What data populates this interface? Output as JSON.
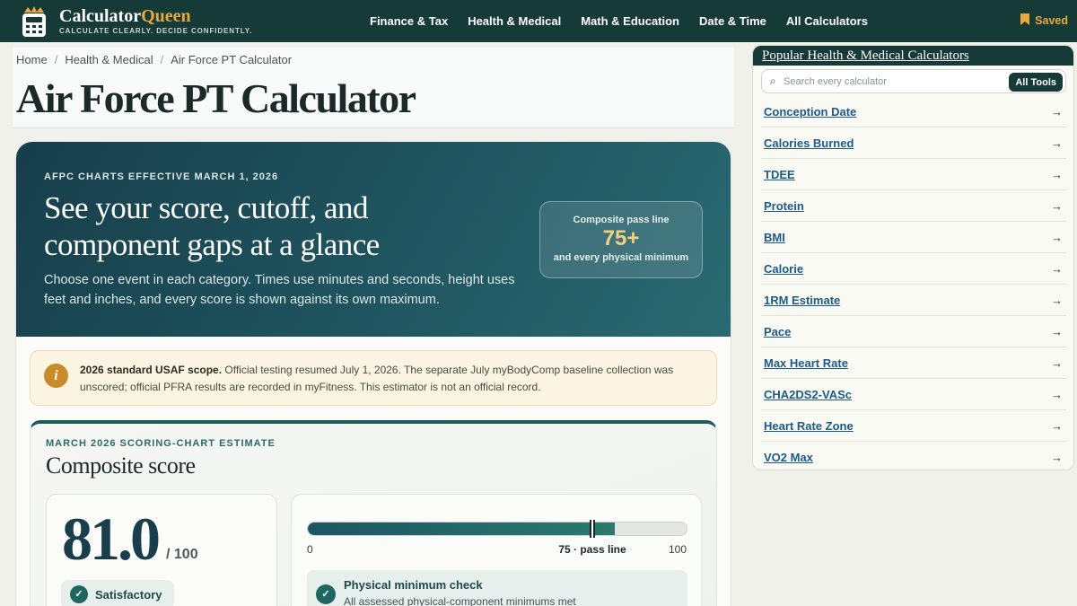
{
  "brand": {
    "name_main": "Calculator",
    "name_accent": "Queen",
    "tagline": "CALCULATE CLEARLY. DECIDE CONFIDENTLY."
  },
  "nav": {
    "items": [
      "Finance & Tax",
      "Health & Medical",
      "Math & Education",
      "Date & Time",
      "All Calculators"
    ],
    "saved_label": "Saved"
  },
  "breadcrumb": [
    "Home",
    "Health & Medical",
    "Air Force PT Calculator"
  ],
  "page_title": "Air Force PT Calculator",
  "hero": {
    "kicker": "AFPC CHARTS EFFECTIVE MARCH 1, 2026",
    "heading": "See your score, cutoff, and component gaps at a glance",
    "description": "Choose one event in each category. Times use minutes and seconds, height uses feet and inches, and every score is shown against its own maximum.",
    "pass_box": {
      "label": "Composite pass line",
      "value": "75+",
      "sub": "and every physical minimum"
    }
  },
  "notice": {
    "bold": "2026 standard USAF scope.",
    "text": " Official testing resumed July 1, 2026. The separate July myBodyComp baseline collection was unscored; official PFRA results are recorded in myFitness. This estimator is not an official record."
  },
  "score": {
    "kicker": "MARCH 2026 SCORING-CHART ESTIMATE",
    "title": "Composite score",
    "value": "81.0",
    "max_label": "/ 100",
    "status": "Satisfactory",
    "bar": {
      "value": 81,
      "min": 0,
      "max": 100,
      "pass_line": 75,
      "min_label": "0",
      "mid_label": "75 · pass line",
      "max_label_scale": "100"
    },
    "physical_check": {
      "title": "Physical minimum check",
      "sub": "All assessed physical-component minimums met"
    }
  },
  "sidebar": {
    "title": "Popular Health & Medical Calculators",
    "search_placeholder": "Search every calculator",
    "all_tools_label": "All Tools",
    "items": [
      "Conception Date",
      "Calories Burned",
      "TDEE",
      "Protein",
      "BMI",
      "Calorie",
      "1RM Estimate",
      "Pace",
      "Max Heart Rate",
      "CHA2DS2-VASc",
      "Heart Rate Zone",
      "VO2 Max"
    ],
    "arrow": "→"
  },
  "colors": {
    "nav_bg": "#153a37",
    "accent_gold": "#e8a83c",
    "hero_start": "#173e4a",
    "link_blue": "#1c5a8a"
  }
}
